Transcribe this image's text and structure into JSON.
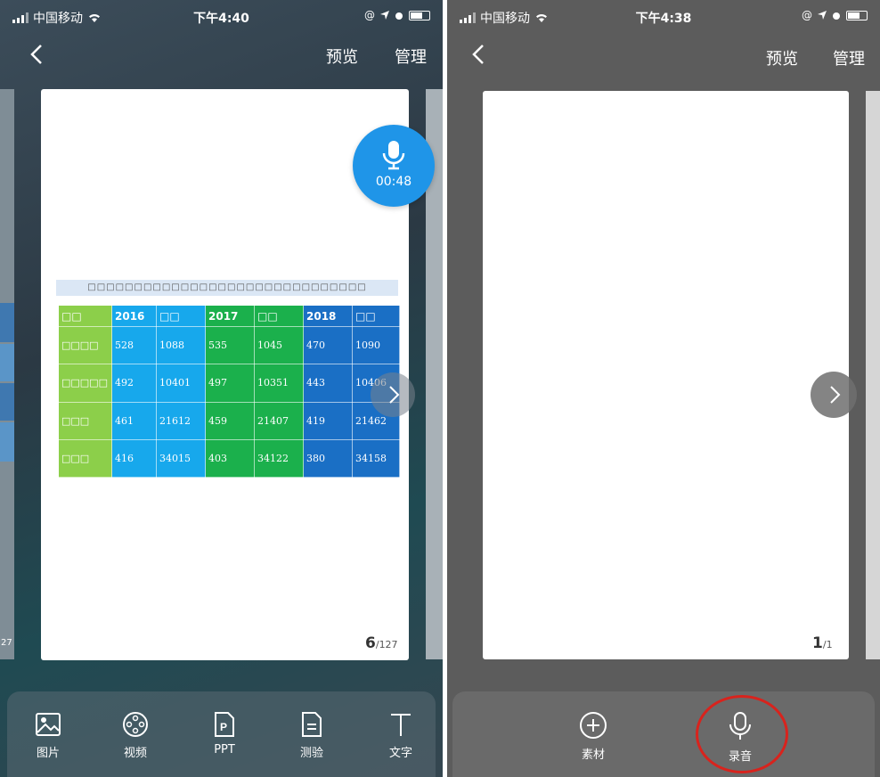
{
  "left": {
    "status": {
      "carrier": "中国移动",
      "time": "下午4:40",
      "extra": "@"
    },
    "nav": {
      "preview": "预览",
      "manage": "管理"
    },
    "mic_timer": "00:48",
    "peek_number": "27",
    "table": {
      "title": "□□□□□□□□□□□□□□□□□□□□□□□□□□□□□□",
      "header": [
        "□□",
        "2016",
        "□□",
        "2017",
        "□□",
        "2018",
        "□□"
      ],
      "rows": [
        [
          "□□□□",
          "528",
          "1088",
          "535",
          "1045",
          "470",
          "1090"
        ],
        [
          "□□□□□",
          "492",
          "10401",
          "497",
          "10351",
          "443",
          "10406"
        ],
        [
          "□□□",
          "461",
          "21612",
          "459",
          "21407",
          "419",
          "21462"
        ],
        [
          "□□□",
          "416",
          "34015",
          "403",
          "34122",
          "380",
          "34158"
        ]
      ]
    },
    "page": {
      "current": "6",
      "total": "127"
    },
    "toolbar": [
      {
        "label": "图片",
        "icon": "image-icon"
      },
      {
        "label": "视频",
        "icon": "video-reel-icon"
      },
      {
        "label": "PPT",
        "icon": "ppt-file-icon"
      },
      {
        "label": "测验",
        "icon": "quiz-icon"
      },
      {
        "label": "文字",
        "icon": "text-icon"
      }
    ]
  },
  "right": {
    "status": {
      "carrier": "中国移动",
      "time": "下午4:38",
      "extra": "@"
    },
    "nav": {
      "preview": "预览",
      "manage": "管理"
    },
    "page": {
      "current": "1",
      "total": "1"
    },
    "toolbar": [
      {
        "label": "素材",
        "icon": "add-circle-icon"
      },
      {
        "label": "录音",
        "icon": "microphone-icon"
      }
    ],
    "highlight_color": "#d8231d"
  }
}
